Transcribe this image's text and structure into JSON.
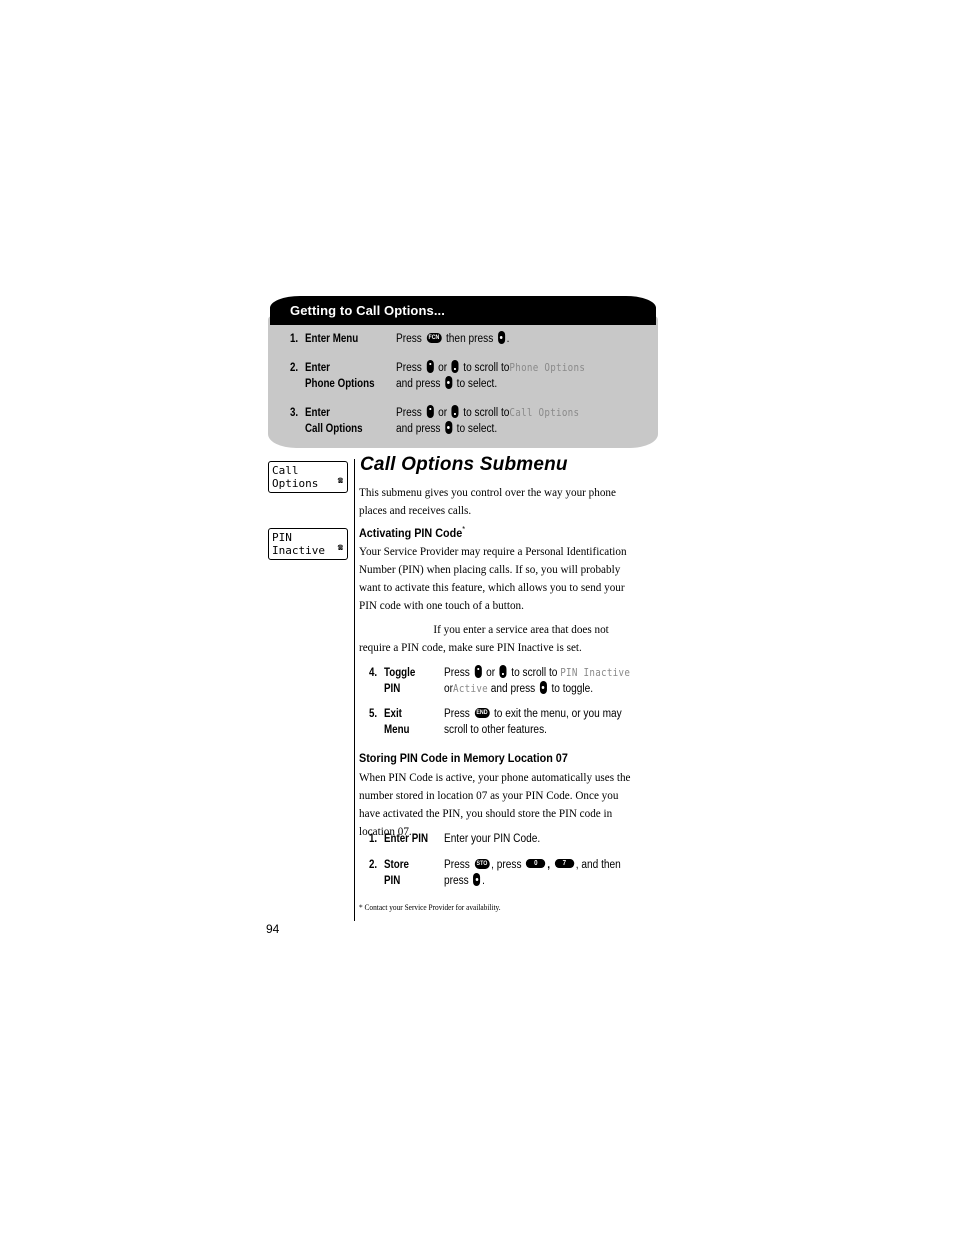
{
  "panel": {
    "title": "Getting to Call Options...",
    "steps": [
      {
        "num": "1.",
        "label_lines": [
          "Enter Menu"
        ],
        "desc": [
          {
            "t": "text",
            "v": "Press "
          },
          {
            "t": "key",
            "v": "FCN"
          },
          {
            "t": "text",
            "v": " then press "
          },
          {
            "t": "key",
            "v": "select"
          },
          {
            "t": "text",
            "v": "."
          }
        ]
      },
      {
        "num": "2.",
        "label_lines": [
          "Enter",
          "Phone Options"
        ],
        "desc_line1_prefix": "Press",
        "desc_line1_or": "or",
        "desc_line1_suffix": "to scroll to",
        "display_target": "Phone Options",
        "desc_line2_prefix": "and press",
        "desc_line2_suffix": "to select."
      },
      {
        "num": "3.",
        "label_lines": [
          "Enter",
          "Call Options"
        ],
        "desc_line1_prefix": "Press",
        "desc_line1_or": "or",
        "desc_line1_suffix": "to scroll to",
        "display_target": "Call Options",
        "desc_line2_prefix": "and press",
        "desc_line2_suffix": "to select."
      }
    ],
    "step1": {
      "prefix": "Press",
      "key": "FCN",
      "middle": "then press",
      "end": "."
    }
  },
  "displays": [
    {
      "line1": "Call",
      "line2": "Options",
      "icon": "phone-icon"
    },
    {
      "line1": "PIN",
      "line2": "Inactive",
      "icon": "phone-icon"
    }
  ],
  "section": {
    "title": "Call Options Submenu",
    "intro": "This submenu gives you control over the way your phone places and receives calls."
  },
  "activating": {
    "heading": "Activating PIN Code",
    "footnote_mark": "*",
    "para1": "Your Service Provider may require a Personal Identification Number (PIN) when placing calls. If so, you will probably want to activate this feature, which allows you to send your PIN code with one touch of a button.",
    "para2": "If you enter a service area that does not require a PIN code, make sure PIN Inactive is set.",
    "steps": [
      {
        "num": "4.",
        "label1": "Toggle",
        "label2": "PIN",
        "line1_prefix": "Press",
        "line1_or": "or",
        "line1_suffix": "to scroll to",
        "display1": "PIN Inactive",
        "line2_or": "or",
        "display2": "Active",
        "line2_mid": "and press",
        "line2_end": "to toggle."
      },
      {
        "num": "5.",
        "label1": "Exit",
        "label2": "Menu",
        "line1_prefix": "Press",
        "key": "END",
        "line1_suffix": "to exit the menu, or you may",
        "line2": "scroll to other features."
      }
    ]
  },
  "storing": {
    "heading": "Storing PIN Code in Memory Location 07",
    "para": "When PIN Code is active, your phone automatically uses the number stored in location 07 as your PIN Code. Once you have activated the PIN, you should store the PIN code in location 07.",
    "steps": [
      {
        "num": "1.",
        "label1": "Enter PIN",
        "line1": "Enter your PIN Code."
      },
      {
        "num": "2.",
        "label1": "Store",
        "label2": "PIN",
        "line1_prefix": "Press",
        "key_sto": "STO",
        "line1_mid": ", press",
        "key_0": "0",
        "comma": ",",
        "key_7": "7",
        "line1_end": ", and then",
        "line2_prefix": "press",
        "line2_end": "."
      }
    ]
  },
  "footnote": "* Contact your Service Provider for availability.",
  "page_number": "94"
}
